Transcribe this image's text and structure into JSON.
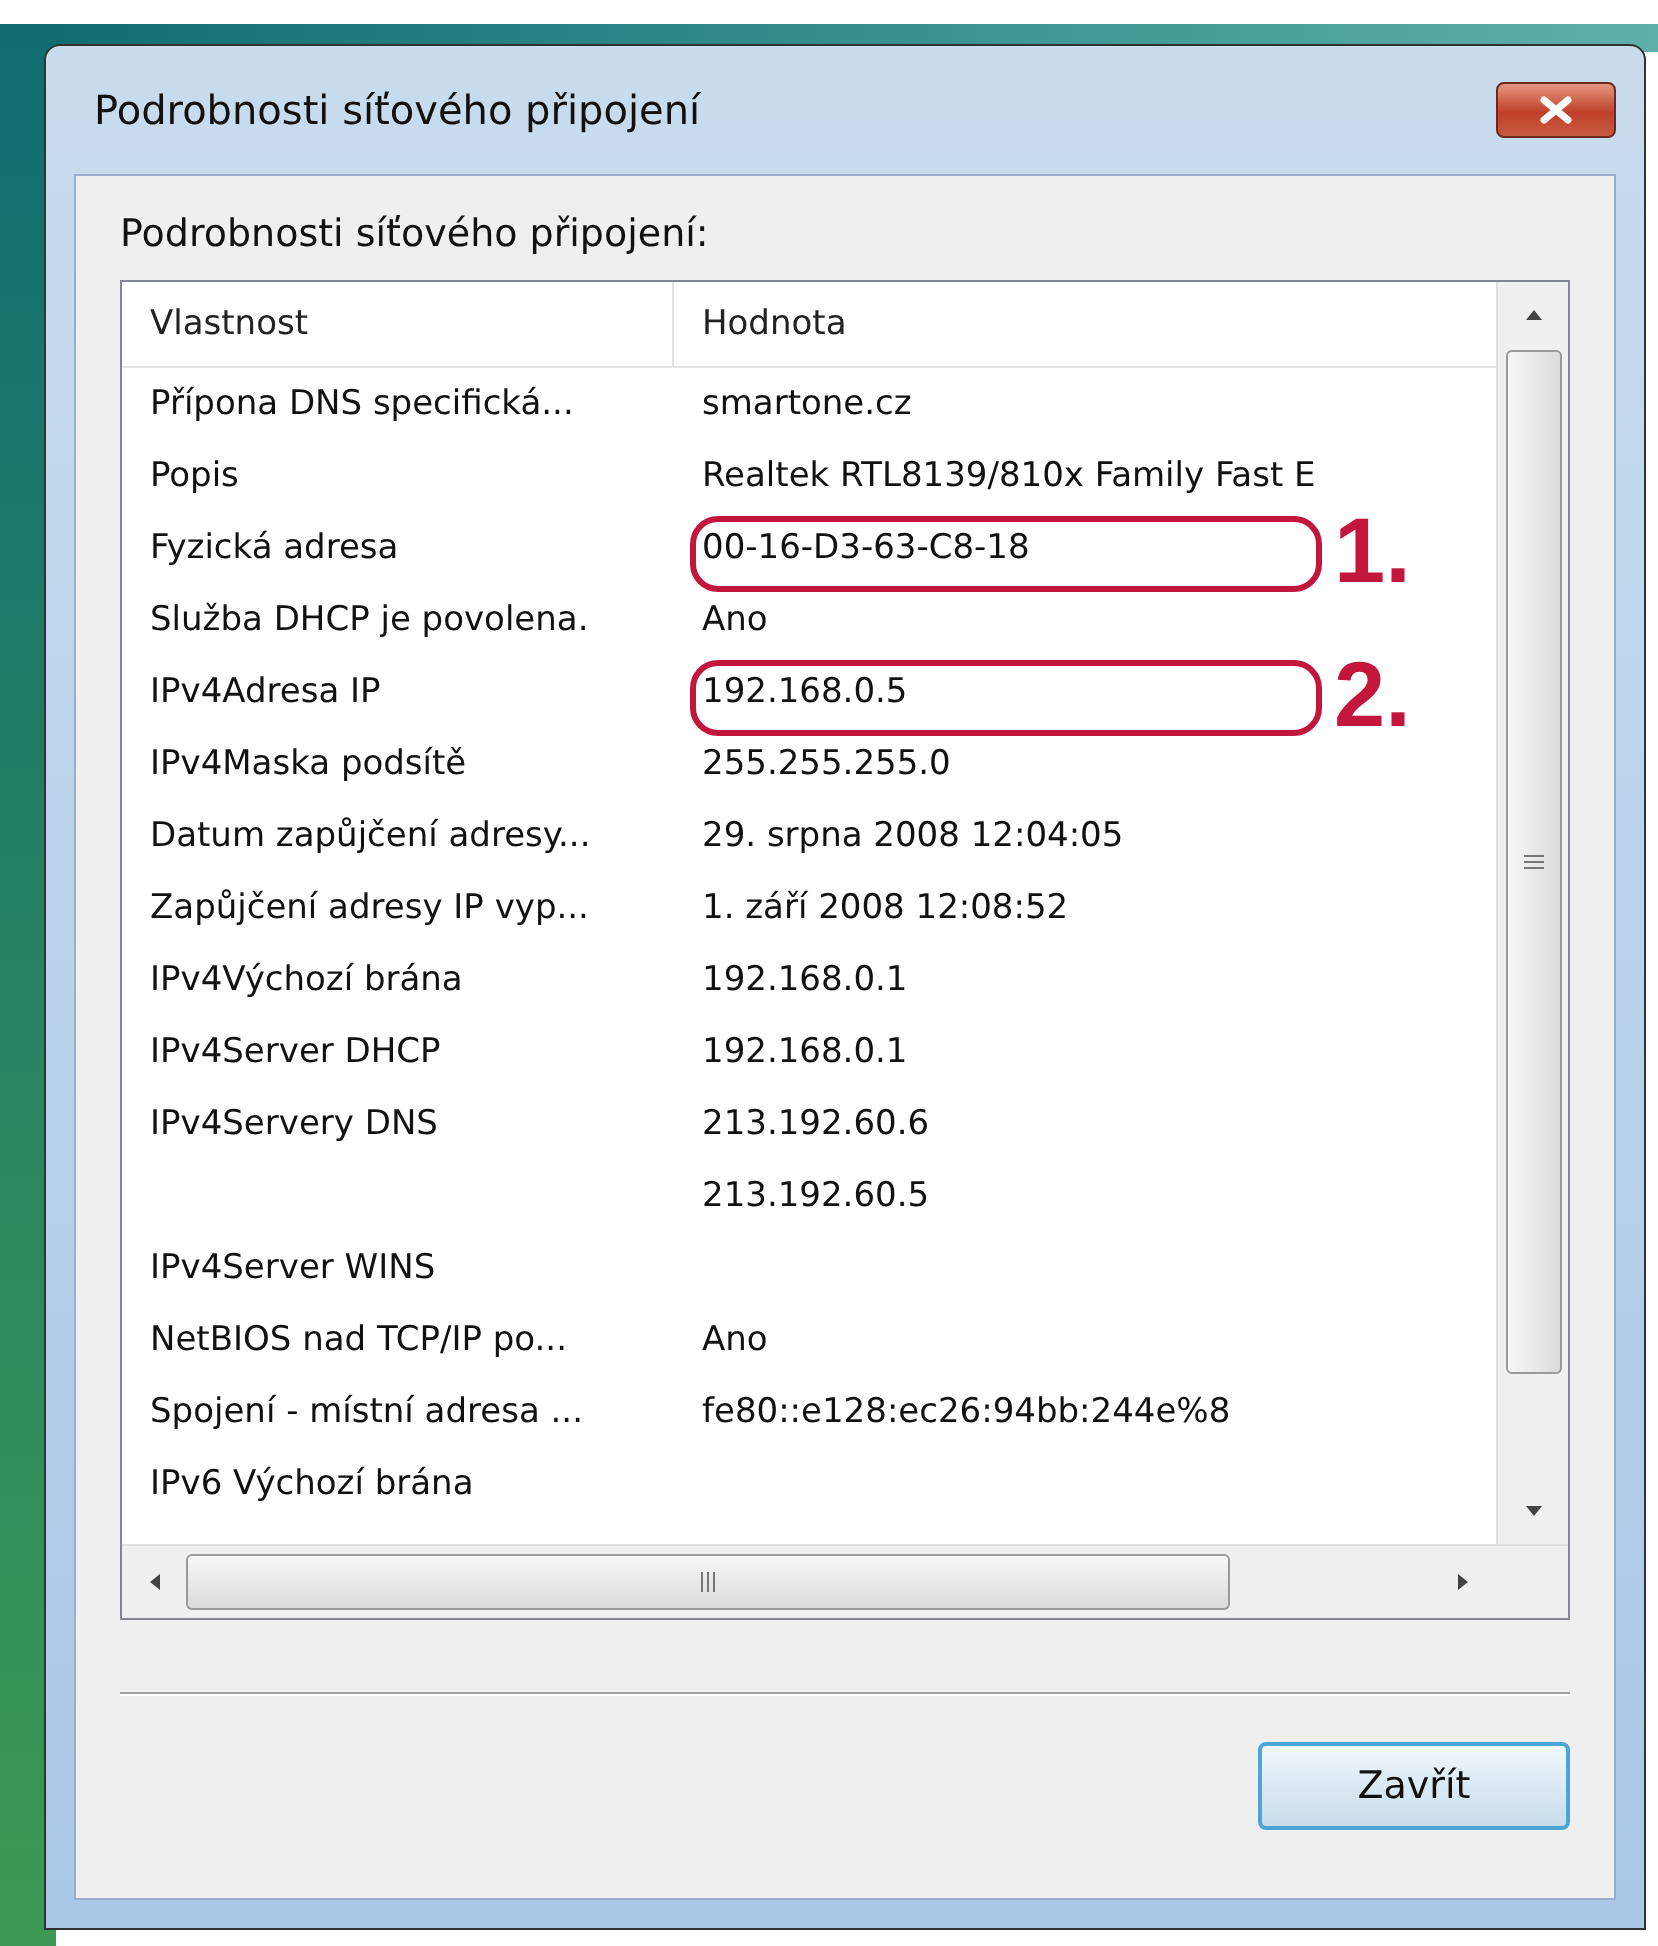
{
  "window": {
    "title": "Podrobnosti síťového připojení"
  },
  "group_label": "Podrobnosti síťového připojení:",
  "table": {
    "columns": [
      "Vlastnost",
      "Hodnota"
    ],
    "rows": [
      {
        "property": "Přípona DNS specifická...",
        "value": "smartone.cz"
      },
      {
        "property": "Popis",
        "value": "Realtek RTL8139/810x Family Fast E"
      },
      {
        "property": "Fyzická adresa",
        "value": "00-16-D3-63-C8-18",
        "callout": "1."
      },
      {
        "property": "Služba DHCP je povolena.",
        "value": "Ano"
      },
      {
        "property": "IPv4Adresa IP",
        "value": "192.168.0.5",
        "callout": "2."
      },
      {
        "property": "IPv4Maska podsítě",
        "value": "255.255.255.0"
      },
      {
        "property": "Datum zapůjčení adresy...",
        "value": "29. srpna 2008 12:04:05"
      },
      {
        "property": "Zapůjčení adresy IP vyp...",
        "value": "1. září 2008 12:08:52"
      },
      {
        "property": "IPv4Výchozí brána",
        "value": "192.168.0.1"
      },
      {
        "property": "IPv4Server DHCP",
        "value": "192.168.0.1"
      },
      {
        "property": "IPv4Servery DNS",
        "value": "213.192.60.6"
      },
      {
        "property": "",
        "value": "213.192.60.5"
      },
      {
        "property": "IPv4Server WINS",
        "value": ""
      },
      {
        "property": "NetBIOS nad TCP/IP po...",
        "value": "Ano"
      },
      {
        "property": "Spojení - místní adresa ...",
        "value": "fe80::e128:ec26:94bb:244e%8"
      },
      {
        "property": "IPv6 Výchozí brána",
        "value": ""
      }
    ]
  },
  "buttons": [
    "Zavřít"
  ]
}
